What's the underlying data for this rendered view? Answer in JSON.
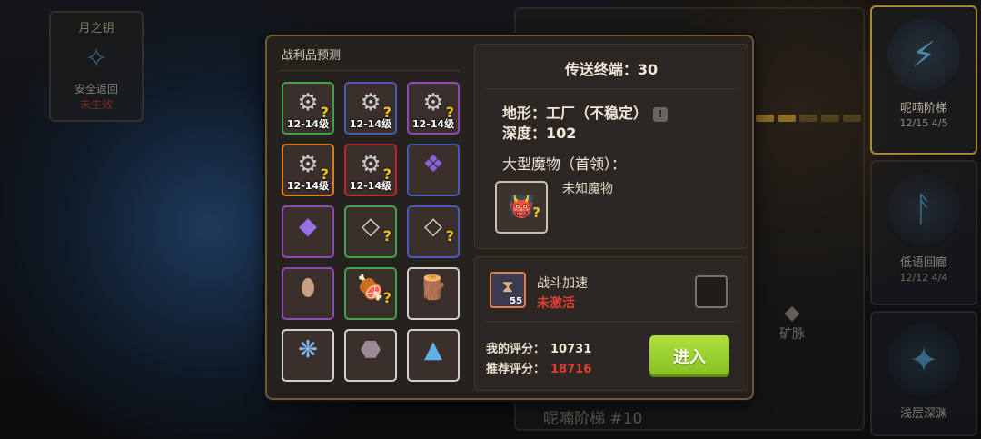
{
  "background": {
    "moon_key": {
      "title": "月之钥",
      "icon": "moon-key-icon",
      "line1": "安全返回",
      "line2": "未生效"
    },
    "zone_list": [
      {
        "name": "呢喃阶梯",
        "progress_a": "12/15",
        "progress_b": "4/5",
        "active": true
      },
      {
        "name": "低语回廊",
        "progress_a": "12/12",
        "progress_b": "4/4",
        "active": false
      },
      {
        "name": "浅层深渊",
        "progress_a": "",
        "progress_b": "",
        "active": false
      }
    ],
    "center_panel": {
      "ore_label": "矿脉",
      "stage_title": "呢喃阶梯 #10"
    }
  },
  "loot": {
    "title": "战利品预测",
    "items": [
      {
        "rarity": "green",
        "icon": "workbench-icon",
        "level": "12-14级",
        "unknown": true
      },
      {
        "rarity": "blue",
        "icon": "workbench-icon",
        "level": "12-14级",
        "unknown": true
      },
      {
        "rarity": "purple",
        "icon": "workbench-icon",
        "level": "12-14级",
        "unknown": true
      },
      {
        "rarity": "orange",
        "icon": "workbench-icon",
        "level": "12-14级",
        "unknown": true
      },
      {
        "rarity": "red",
        "icon": "workbench-icon",
        "level": "12-14级",
        "unknown": true
      },
      {
        "rarity": "blue",
        "icon": "purple-crystal-shards-icon",
        "level": "",
        "unknown": false
      },
      {
        "rarity": "purple",
        "icon": "purple-crystal-icon",
        "level": "",
        "unknown": false
      },
      {
        "rarity": "green",
        "icon": "white-crystal-icon",
        "level": "",
        "unknown": true
      },
      {
        "rarity": "blue",
        "icon": "white-crystal-icon",
        "level": "",
        "unknown": true
      },
      {
        "rarity": "purple",
        "icon": "egg-icon",
        "level": "",
        "unknown": false
      },
      {
        "rarity": "green",
        "icon": "meat-icon",
        "level": "",
        "unknown": true
      },
      {
        "rarity": "white",
        "icon": "wood-logs-icon",
        "level": "",
        "unknown": false
      },
      {
        "rarity": "white",
        "icon": "blue-crystal-cluster-icon",
        "level": "",
        "unknown": false
      },
      {
        "rarity": "white",
        "icon": "stone-ore-icon",
        "level": "",
        "unknown": false
      },
      {
        "rarity": "white",
        "icon": "blue-sand-pile-icon",
        "level": "",
        "unknown": false
      }
    ]
  },
  "info": {
    "terminal": "传送终端：30",
    "terrain_label": "地形：",
    "terrain_value": "工厂（不稳定）",
    "depth_label": "深度：",
    "depth_value": "102",
    "boss_label": "大型魔物（首领）：",
    "boss_name": "未知魔物"
  },
  "battle": {
    "boost_name": "战斗加速",
    "boost_status": "未激活",
    "boost_count": "55",
    "my_score_label": "我的评分：",
    "my_score": "10731",
    "rec_score_label": "推荐评分：",
    "rec_score": "18716",
    "enter_label": "进入"
  },
  "colors": {
    "accent_green": "#9ad030",
    "warning_red": "#e04030",
    "border_gold": "#6a5838"
  }
}
